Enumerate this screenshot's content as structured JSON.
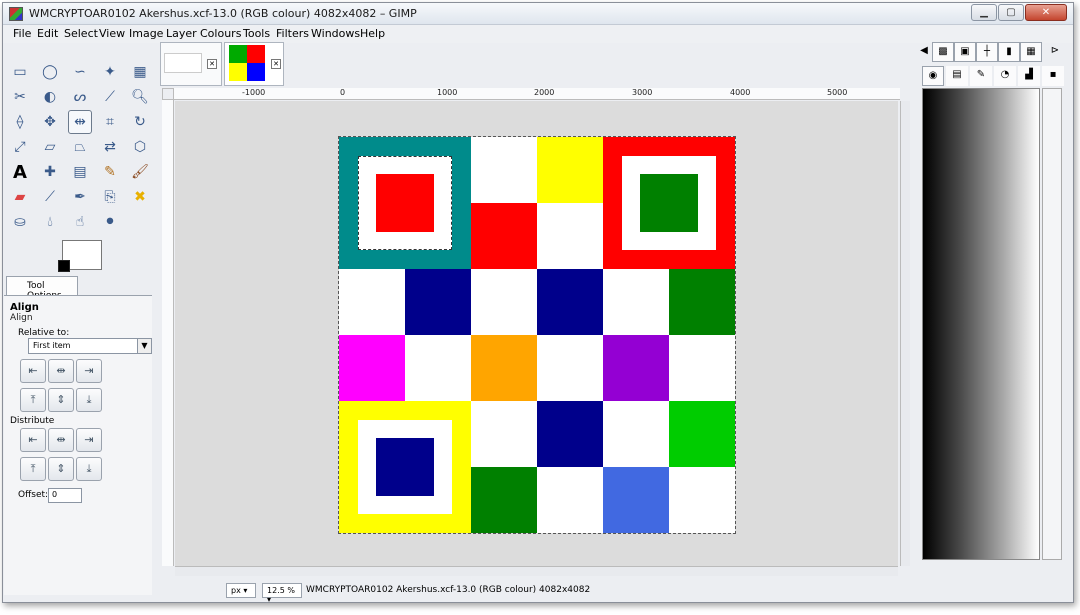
{
  "window": {
    "title": "WMCRYPTOAR0102 Akershus.xcf-13.0 (RGB colour) 4082x4082 – GIMP",
    "controls": {
      "minimize": "▁",
      "maximize": "▢",
      "close": "✕"
    }
  },
  "menu": [
    "File",
    "Edit",
    "Select",
    "View",
    "Image",
    "Layer",
    "Colours",
    "Tools",
    "Filters",
    "Windows",
    "Help"
  ],
  "toolbox": {
    "tools": [
      "rect-select",
      "ellipse-select",
      "free-select",
      "fuzzy-select",
      "select-by-color",
      "scissors",
      "foreground-select",
      "paths",
      "color-picker",
      "zoom",
      "measure",
      "move",
      "align",
      "crop",
      "rotate",
      "scale",
      "shear",
      "perspective",
      "flip",
      "cage",
      "text",
      "heal",
      "gradient",
      "pencil",
      "paintbrush",
      "eraser",
      "airbrush",
      "ink",
      "clone",
      "smudge",
      "dodge",
      "blur",
      "convolve",
      "bucket-fill"
    ]
  },
  "tool_options": {
    "tab_label": "Tool Options",
    "title": "Align",
    "subtitle": "Align",
    "relative_to_label": "Relative to:",
    "relative_to_value": "First item",
    "distribute_label": "Distribute",
    "offset_label": "Offset:",
    "offset_value": "0"
  },
  "rulers": {
    "h_labels": [
      "-1000",
      "0",
      "1000",
      "2000",
      "3000",
      "4000",
      "5000"
    ]
  },
  "status": {
    "unit": "px",
    "zoom": "12.5 %",
    "text": "WMCRYPTOAR0102 Akershus.xcf-13.0 (RGB colour) 4082x4082"
  },
  "colors": {
    "teal": "#008b8b",
    "red": "#ff0000",
    "green": "#008000",
    "navy": "#00008b",
    "yellow": "#ffff00",
    "magenta": "#ff00ff",
    "orange": "#ffa500",
    "purple": "#9400d3",
    "lime": "#00cc00",
    "royal": "#4169e1",
    "white": "#ffffff"
  }
}
